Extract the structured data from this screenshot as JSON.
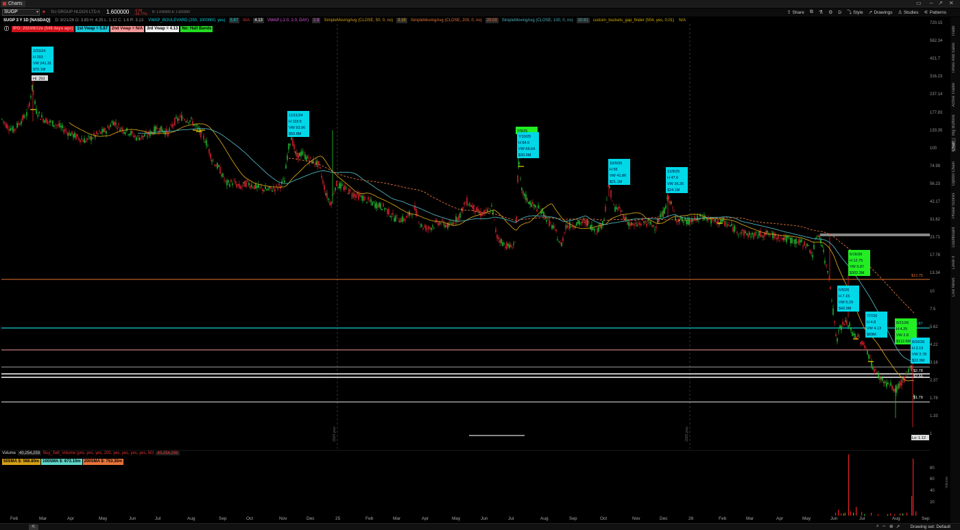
{
  "window": {
    "tab_title": "Charts"
  },
  "toolbar": {
    "symbol": "SUGP",
    "company": "SU GROUP HLDGS LTD A",
    "price": "1.600000",
    "change": "-0.56",
    "change_pct": "-25.77%",
    "bid_ask": "B: 1.640000  A: 1.600000",
    "share": "Share",
    "style": "Style",
    "drawings": "Drawings",
    "studies": "Studies",
    "patterns": "Patterns",
    "period": "D"
  },
  "study_bar": {
    "title": "SUGP 3 Y 1D [NASDAQ]",
    "ohlc": "D: 8/21/26   O: 3.83   H: 4.25   L: 1.12   C: 1.6   R: 3.13",
    "vwap_boulevard": "VWAP_BOULEVARD (250, 1000000, yes)",
    "vwap_boulevard_val": "5.87",
    "na1": "N/A",
    "val413": "4.13",
    "vwap": "VWAP (-2.0, 2.0, DAY)",
    "vwap_val": "2.8",
    "sma50": "SimpleMovingAvg (CLOSE, 50, 0, no)",
    "sma50_val": "3.16",
    "sma200": "SimpleMovingAvg (CLOSE, 200, 0, no)",
    "sma200_val": "20.03",
    "sma100": "SimpleMovingAvg (CLOSE, 100, 0, no)",
    "sma100_val": "10.91",
    "gap_finder": "custom_buckets_gap_finder (504, yes, 0.01)",
    "na2": "N/A"
  },
  "bands": {
    "ipo": "IPO: 2024/8/12e (548 days ago)",
    "vwap1": "1st Vwap = 5.87",
    "vwap2": "2nd Vwap = N/A",
    "vwap3": "3rd Vwap = 4.13",
    "halt": "No: Halt Bands"
  },
  "colors": {
    "up": "#22cc33",
    "down": "#ee2233",
    "sma50": "#d4a017",
    "sma100": "#4fb3bf",
    "sma200": "#e8743b",
    "cyan": "#00d8e8",
    "green_label": "#22ee22"
  },
  "y_axis": [
    "720.15",
    "562.34",
    "421.7",
    "316.23",
    "237.14",
    "177.83",
    "133.35",
    "100",
    "74.99",
    "56.23",
    "42.17",
    "31.62",
    "23.71",
    "17.78",
    "13.34",
    "10",
    "7.5",
    "5.62",
    "4.22",
    "3.16",
    "2.37",
    "1.78",
    "1.33",
    "1"
  ],
  "price_tags": {
    "p2003": "20.03",
    "p1275": "$12.75",
    "p1091": "10.91",
    "p587": "5.87",
    "p413": "4.13",
    "p316": "3.16",
    "p278": "$2.78",
    "p28": "2.8",
    "p266": "$2.66",
    "p179": "$1.79",
    "p16": "1.6",
    "lo": "Lo: 1.12",
    "hi": "Hi: 293"
  },
  "annotations": [
    {
      "lines": [
        "2/23/24",
        "H 293",
        "VW 241.31",
        "$70.1M"
      ],
      "color": "cyan"
    },
    {
      "lines": [
        "11/11/24",
        "H 118.5",
        "VW 93.96",
        "$50.8M"
      ],
      "color": "cyan"
    },
    {
      "lines": [
        "7/9/25"
      ],
      "color": "green"
    },
    {
      "lines": [
        "7/10/25",
        "H 84.5",
        "VW 69.64",
        "$30.5M"
      ],
      "color": "cyan"
    },
    {
      "lines": [
        "10/9/25",
        "H 55",
        "VW 41.86",
        "$21.1M"
      ],
      "color": "cyan"
    },
    {
      "lines": [
        "12/8/25",
        "H 47.6",
        "VW 36.35",
        "$24.1M"
      ],
      "color": "cyan"
    },
    {
      "lines": [
        "6/16/26",
        "H 12.75",
        "VW 5.87",
        "$302.3M"
      ],
      "color": "green"
    },
    {
      "lines": [
        "6/5/26",
        "H 7.15",
        "VW 5.29",
        "$42.9M"
      ],
      "color": "cyan"
    },
    {
      "lines": [
        "7/7/26",
        "H 4.8",
        "VW 4.13",
        "$69M"
      ],
      "color": "cyan"
    },
    {
      "lines": [
        "8/21/26",
        "H 4.25",
        "VW 2.8",
        "$112.6M"
      ],
      "color": "green"
    },
    {
      "lines": [
        "8/20/26",
        "H 3.13",
        "VW 2.78",
        "$22.9M"
      ],
      "color": "cyan"
    }
  ],
  "year_markers": [
    "2024 year",
    "2025 year"
  ],
  "volume": {
    "label": "Volume",
    "value": "40,254,259",
    "study": "Buy_Sell_Volume (yes, yes, yes, 200, yes, yes, yes, yes, 50)",
    "study_val": "40,254,259",
    "ma50": "50SMA $: 568.80m",
    "ma100": "100SMA $: 673.10m",
    "ma200": "200SMA $: 753.30m",
    "y_axis": [
      "80",
      "60",
      "40",
      "20"
    ],
    "side_label": "Volume"
  },
  "x_axis": [
    "Feb",
    "Mar",
    "Apr",
    "May",
    "Jun",
    "Jul",
    "Aug",
    "Sep",
    "Oct",
    "Nov",
    "Dec",
    "25",
    "Feb",
    "Mar",
    "Apr",
    "May",
    "Jun",
    "Jul",
    "Aug",
    "Sep",
    "Oct",
    "Nov",
    "Dec",
    "26",
    "Feb",
    "Mar",
    "Apr",
    "May",
    "Jun",
    "Jul",
    "Aug",
    "Sep"
  ],
  "right_sidebar": [
    "Trade",
    "Times And Sales",
    "Active Trader",
    "Big Buttons",
    "Chart",
    "Option Chain",
    "Phase Scores",
    "Dashboard",
    "Level II",
    "Live News"
  ],
  "status": {
    "drawing_set": "Drawing set: Default"
  }
}
